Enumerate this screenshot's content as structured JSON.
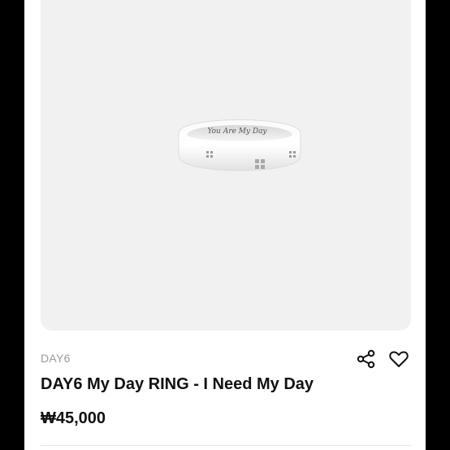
{
  "product": {
    "brand": "DAY6",
    "title": "DAY6 My Day RING - I Need My Day",
    "price": "₩45,000",
    "engraving": "You Are My Day"
  },
  "actions": {
    "share_icon": "share-icon",
    "like_icon": "heart-icon"
  },
  "colors": {
    "image_bg": "#f1f1f1",
    "text": "#111111",
    "brand_text": "#9a9a9a"
  }
}
